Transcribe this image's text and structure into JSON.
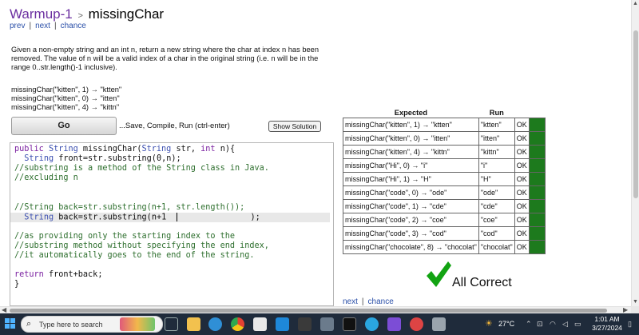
{
  "header": {
    "crumb": "Warmup-1",
    "sep": ">",
    "problem": "missingChar"
  },
  "nav_top": {
    "prev": "prev",
    "next": "next",
    "chance": "chance",
    "pipe": "|"
  },
  "description": "Given a non-empty string and an int n, return a new string where the char at index n has been removed. The value of n will be a valid index of a char in the original string (i.e. n will be in the range 0..str.length()-1 inclusive).",
  "examples": [
    "missingChar(\"kitten\", 1) → \"ktten\"",
    "missingChar(\"kitten\", 0) → \"itten\"",
    "missingChar(\"kitten\", 4) → \"kittn\""
  ],
  "controls": {
    "go_label": "Go",
    "go_hint": "...Save, Compile, Run (ctrl-enter)",
    "show_solution": "Show Solution"
  },
  "code_lines": [
    "public String missingChar(String str, int n){",
    "  String front=str.substring(0,n);",
    "//substring is a method of the String class in Java.",
    "//excluding n",
    "",
    "",
    "//String back=str.substring(n+1, str.length());",
    "  String back=str.substring(n+1               );",
    "",
    "//as providing only the starting index to the",
    "//substring method without specifying the end index,",
    "//it automatically goes to the end of the string.",
    "",
    "return front+back;",
    "}"
  ],
  "results": {
    "headers": {
      "expected": "Expected",
      "run": "Run"
    },
    "rows": [
      {
        "expected": "missingChar(\"kitten\", 1) → \"ktten\"",
        "run": "\"ktten\"",
        "status": "OK"
      },
      {
        "expected": "missingChar(\"kitten\", 0) → \"itten\"",
        "run": "\"itten\"",
        "status": "OK"
      },
      {
        "expected": "missingChar(\"kitten\", 4) → \"kittn\"",
        "run": "\"kittn\"",
        "status": "OK"
      },
      {
        "expected": "missingChar(\"Hi\", 0) → \"i\"",
        "run": "\"i\"",
        "status": "OK"
      },
      {
        "expected": "missingChar(\"Hi\", 1) → \"H\"",
        "run": "\"H\"",
        "status": "OK"
      },
      {
        "expected": "missingChar(\"code\", 0) → \"ode\"",
        "run": "\"ode\"",
        "status": "OK"
      },
      {
        "expected": "missingChar(\"code\", 1) → \"cde\"",
        "run": "\"cde\"",
        "status": "OK"
      },
      {
        "expected": "missingChar(\"code\", 2) → \"coe\"",
        "run": "\"coe\"",
        "status": "OK"
      },
      {
        "expected": "missingChar(\"code\", 3) → \"cod\"",
        "run": "\"cod\"",
        "status": "OK"
      },
      {
        "expected": "missingChar(\"chocolate\", 8) → \"chocolat\"",
        "run": "\"chocolat\"",
        "status": "OK"
      }
    ],
    "pass_color": "#1d7a1d"
  },
  "summary": {
    "text": "All Correct",
    "icon": "green-checkmark-icon",
    "color": "#12a312"
  },
  "nav_bottom": {
    "next": "next",
    "chance": "chance",
    "pipe": "|"
  },
  "taskbar": {
    "search_placeholder": "Type here to search",
    "weather": "27°C",
    "time": "1:01 AM",
    "date": "3/27/2024",
    "icons": [
      "task-view-icon",
      "file-explorer-icon",
      "edge-browser-icon",
      "chrome-icon",
      "paint-icon",
      "vscode-icon",
      "app-icon",
      "calculator-icon",
      "terminal-icon",
      "browser-icon",
      "photos-icon",
      "app-icon-2"
    ]
  }
}
